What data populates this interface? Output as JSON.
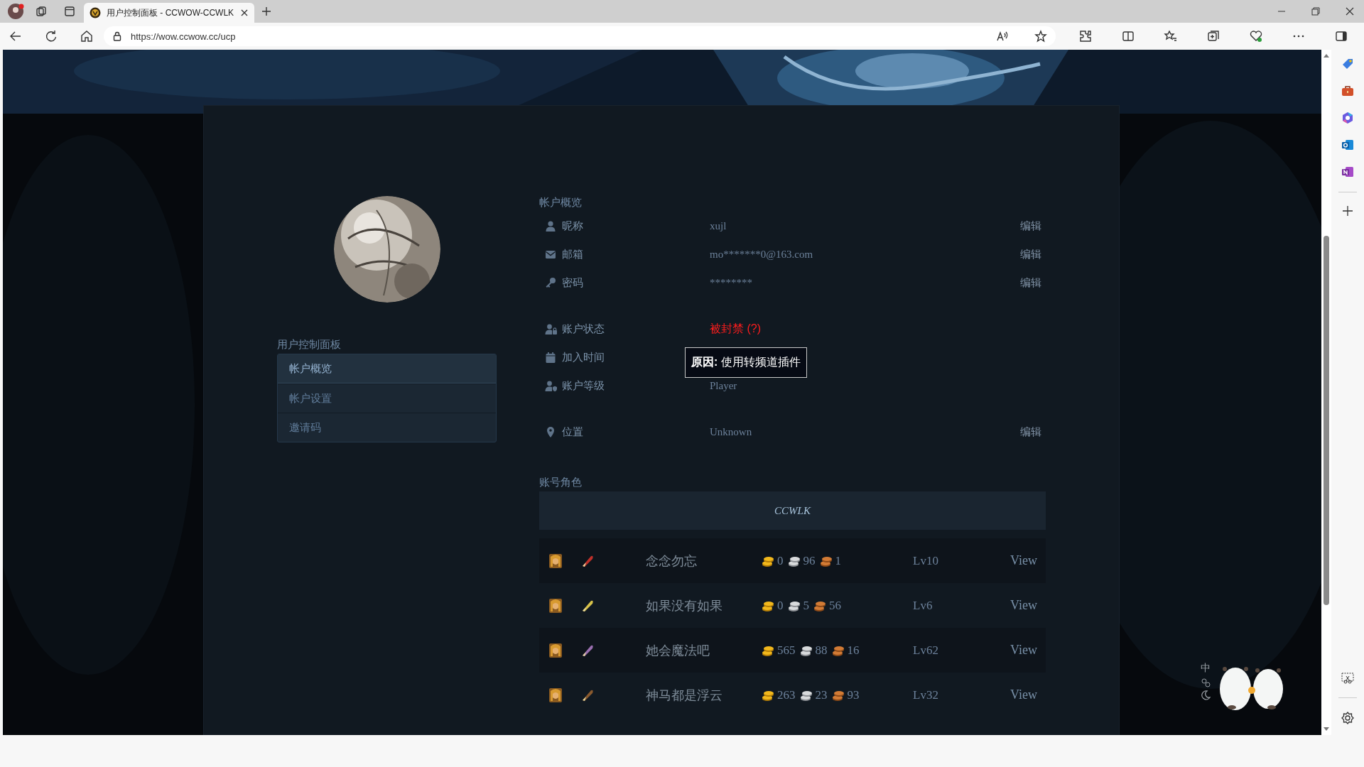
{
  "browser": {
    "tab_title": "用户控制面板 - CCWOW-CCWLK",
    "url": "https://wow.ccwow.cc/ucp"
  },
  "sidebar": {
    "title": "用户控制面板",
    "items": [
      {
        "label": "帐户概览",
        "selected": true
      },
      {
        "label": "帐户设置",
        "selected": false
      },
      {
        "label": "邀请码",
        "selected": false
      }
    ]
  },
  "overview": {
    "title": "帐户概览",
    "groups": [
      [
        {
          "label": "昵称",
          "value": "xujl",
          "edit": "编辑"
        },
        {
          "label": "邮箱",
          "value": "mo*******0@163.com",
          "edit": "编辑"
        },
        {
          "label": "密码",
          "value": "********",
          "edit": "编辑"
        }
      ],
      [
        {
          "label": "账户状态",
          "value": "被封禁 (?)",
          "kind": "banned",
          "tooltip": "**原因:** 使用转频道插件"
        },
        {
          "label": "加入时间"
        },
        {
          "label": "账户等级",
          "value": "Player"
        }
      ],
      [
        {
          "label": "位置",
          "value": "Unknown",
          "edit": "编辑"
        }
      ]
    ]
  },
  "characters": {
    "title": "账号角色",
    "realm": "CCWLK",
    "rows": [
      {
        "color": "#c0302a",
        "name": "念念勿忘",
        "gold": "0",
        "silver": "96",
        "copper": "1",
        "lv": "Lv10",
        "action": "View"
      },
      {
        "color": "#d8c24a",
        "name": "如果没有如果",
        "gold": "0",
        "silver": "5",
        "copper": "56",
        "lv": "Lv6",
        "action": "View"
      },
      {
        "color": "#9a6fb0",
        "name": "她会魔法吧",
        "gold": "565",
        "silver": "88",
        "copper": "16",
        "lv": "Lv62",
        "action": "View"
      },
      {
        "color": "#8a5a2e",
        "name": "神马都是浮云",
        "gold": "263",
        "silver": "23",
        "copper": "93",
        "lv": "Lv32",
        "action": "View"
      }
    ]
  },
  "widget": {
    "ime": "中"
  }
}
